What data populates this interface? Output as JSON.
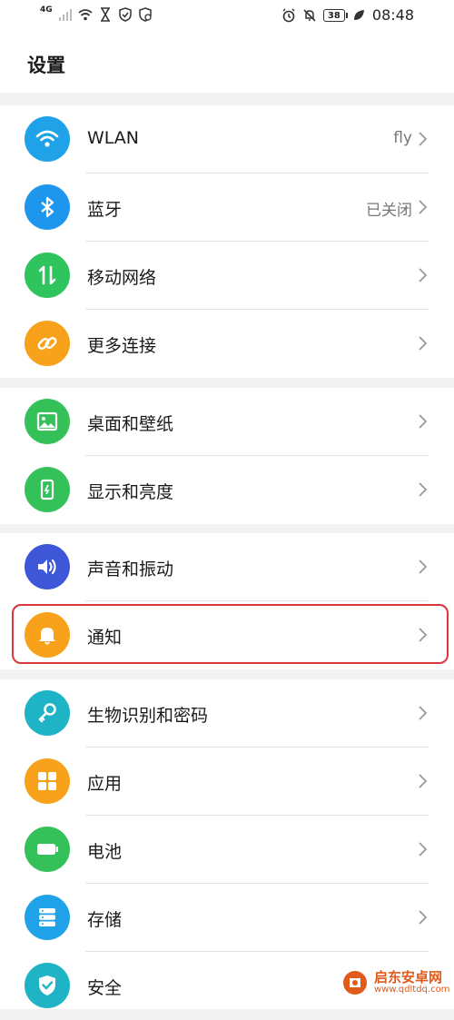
{
  "status_bar": {
    "network": "4G",
    "battery": "38",
    "time": "08:48",
    "icons": [
      "signal-icon",
      "wifi-icon",
      "hourglass-icon",
      "shield-icon",
      "checkshield-icon",
      "alarm-icon",
      "mute-icon",
      "leaf-icon"
    ]
  },
  "header": {
    "title": "设置"
  },
  "groups": [
    {
      "items": [
        {
          "label": "WLAN",
          "value": "fly",
          "icon": "wifi-icon",
          "color": "#1fa2e8"
        },
        {
          "label": "蓝牙",
          "value": "已关闭",
          "icon": "bluetooth-icon",
          "color": "#1f96ee"
        },
        {
          "label": "移动网络",
          "value": "",
          "icon": "mobile-data-icon",
          "color": "#2fc45e"
        },
        {
          "label": "更多连接",
          "value": "",
          "icon": "link-icon",
          "color": "#f7a21a"
        }
      ]
    },
    {
      "items": [
        {
          "label": "桌面和壁纸",
          "value": "",
          "icon": "wallpaper-icon",
          "color": "#35c15a"
        },
        {
          "label": "显示和亮度",
          "value": "",
          "icon": "display-icon",
          "color": "#35c15a"
        }
      ]
    },
    {
      "items": [
        {
          "label": "声音和振动",
          "value": "",
          "icon": "speaker-icon",
          "color": "#3d57d8"
        },
        {
          "label": "通知",
          "value": "",
          "icon": "bell-icon",
          "color": "#f7a21a"
        }
      ]
    },
    {
      "items": [
        {
          "label": "生物识别和密码",
          "value": "",
          "icon": "key-icon",
          "color": "#1fb3c6"
        },
        {
          "label": "应用",
          "value": "",
          "icon": "apps-icon",
          "color": "#f7a21a"
        },
        {
          "label": "电池",
          "value": "",
          "icon": "battery-icon",
          "color": "#35c15a"
        },
        {
          "label": "存储",
          "value": "",
          "icon": "storage-icon",
          "color": "#1fa2e8"
        },
        {
          "label": "安全",
          "value": "",
          "icon": "security-icon",
          "color": "#1fb3c6"
        }
      ]
    }
  ],
  "watermark": {
    "main": "启东安卓网",
    "sub": "www.qdltdq.com"
  },
  "colors": {
    "highlight": "#d9363e",
    "background": "#f2f2f2"
  }
}
